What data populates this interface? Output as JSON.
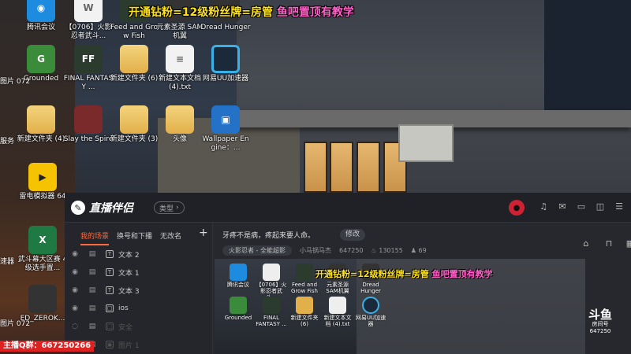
{
  "overlay": {
    "banner_yellow": "开通钻粉=12级粉丝牌=房管",
    "banner_pink": "鱼吧置顶有教学",
    "qq_group": "主播Q群：667250266"
  },
  "desktop": {
    "icons": [
      {
        "label": "腾讯会议",
        "icon": "meeting-icon"
      },
      {
        "label": "【0706】火影忍者武斗...",
        "icon": "doc-icon"
      },
      {
        "label": "Feed and Grow Fish",
        "icon": "game-icon"
      },
      {
        "label": "元素圣源 SAM机翼",
        "icon": "game-icon"
      },
      {
        "label": "Dread Hunger",
        "icon": "game-icon"
      },
      {
        "label": "Grounded",
        "icon": "game-icon"
      },
      {
        "label": "FINAL FANTASY ...",
        "icon": "game-icon"
      },
      {
        "label": "新建文件夹 (6)",
        "icon": "folder-icon"
      },
      {
        "label": "新建文本文档 (4).txt",
        "icon": "text-file-icon"
      },
      {
        "label": "网易UU加速器",
        "icon": "uu-accelerator-icon"
      },
      {
        "label": "新建文件夹 (4)",
        "icon": "folder-icon"
      },
      {
        "label": "Slay the Spire",
        "icon": "game-icon"
      },
      {
        "label": "新建文件夹 (3)",
        "icon": "folder-icon"
      },
      {
        "label": "头像",
        "icon": "folder-icon"
      },
      {
        "label": "Wallpaper Engine：...",
        "icon": "wallpaper-engine-icon"
      },
      {
        "label": "雷电模拟器 64",
        "icon": "emulator-icon"
      },
      {
        "label": "武斗幕大区赛 4级选手置...",
        "icon": "excel-icon"
      },
      {
        "label": "ED_ZEROK...",
        "icon": "image-icon"
      }
    ],
    "partial_labels": [
      "图片 072",
      "服务",
      "速器",
      "图片 072"
    ]
  },
  "app": {
    "title": "直播伴侣",
    "type_button": "类型",
    "tabs": [
      "我的场景",
      "换号和下播",
      "无改名"
    ],
    "active_tab": "我的场景",
    "sources": [
      {
        "name": "文本 2",
        "kind": "T"
      },
      {
        "name": "文本 1",
        "kind": "T"
      },
      {
        "name": "文本 3",
        "kind": "T"
      },
      {
        "name": "ios",
        "kind": "□"
      },
      {
        "name": "安全",
        "kind": "□"
      },
      {
        "name": "图片 1",
        "kind": "▣"
      }
    ],
    "stream_title": "牙疼不是病，疼起来要人命。",
    "edit_button": "修改",
    "category": "火影忍者 - 全能超影",
    "streamer_name": "小马锅马杰",
    "room_id": "647250",
    "hot_value": "130155",
    "fans": "69"
  },
  "preview": {
    "icons": [
      {
        "label": "腾讯会议"
      },
      {
        "label": "【0706】火影忍者武斗..."
      },
      {
        "label": "Feed and Grow Fish"
      },
      {
        "label": "元素圣源 SAM机翼"
      },
      {
        "label": "Dread Hunger"
      },
      {
        "label": "Grounded"
      },
      {
        "label": "FINAL FANTASY ..."
      },
      {
        "label": "新建文件夹 (6)"
      },
      {
        "label": "新建文本文档 (4).txt"
      },
      {
        "label": "网易UU加速器"
      }
    ]
  },
  "watermark": {
    "brand": "斗鱼",
    "room_label": "房间号",
    "room_number": "647250"
  },
  "colors": {
    "banner_yellow": "#ffe31a",
    "banner_pink": "#ff62c8",
    "accent": "#ff6a3d"
  }
}
